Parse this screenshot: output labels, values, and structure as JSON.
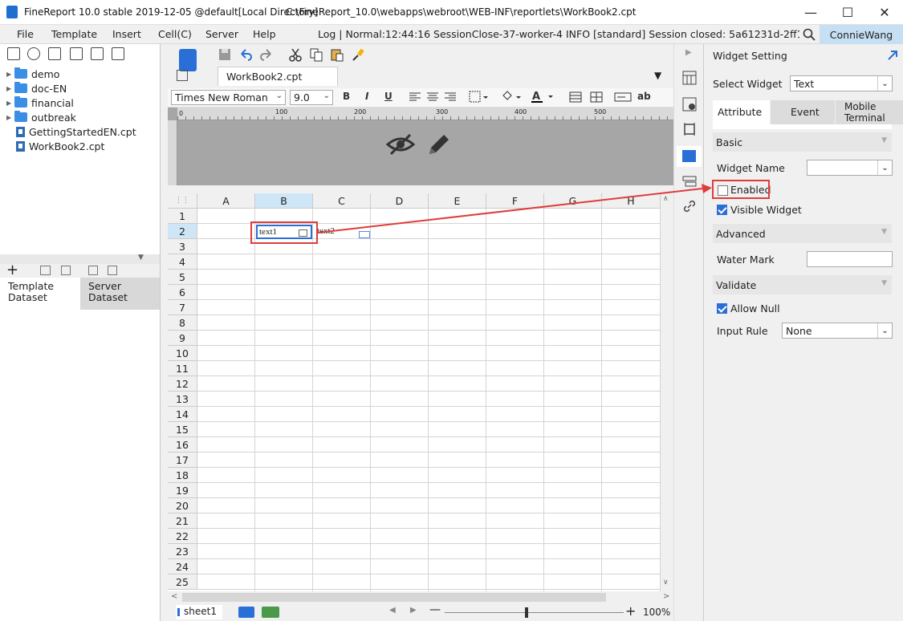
{
  "titlebar": {
    "app_title": "FineReport 10.0 stable 2019-12-05 @default[Local Directory]",
    "path": "C:\\FineReport_10.0\\webapps\\webroot\\WEB-INF\\reportlets\\WorkBook2.cpt"
  },
  "menu": {
    "items": [
      "File",
      "Template",
      "Insert",
      "Cell(C)",
      "Server",
      "Help"
    ],
    "log": "Log | Normal:12:44:16 SessionClose-37-worker-4 INFO [standard] Session closed: 5a61231d-2ff1-434e-942...",
    "user": "ConnieWang"
  },
  "tree": {
    "folders": [
      "demo",
      "doc-EN",
      "financial",
      "outbreak"
    ],
    "files": [
      "GettingStartedEN.cpt",
      "WorkBook2.cpt"
    ]
  },
  "dataset_tabs": [
    "Template Dataset",
    "Server Dataset"
  ],
  "editor": {
    "file_tab": "WorkBook2.cpt",
    "font_name": "Times New Roman",
    "font_size": "9.0",
    "format_buttons": [
      "B",
      "I",
      "U"
    ],
    "ab_button": "ab",
    "ruler_labels": [
      "0",
      "100",
      "200",
      "300",
      "400",
      "500"
    ]
  },
  "sheet": {
    "columns": [
      "A",
      "B",
      "C",
      "D",
      "E",
      "F",
      "G",
      "H"
    ],
    "rows": [
      "1",
      "2",
      "3",
      "4",
      "5",
      "6",
      "7",
      "8",
      "9",
      "10",
      "11",
      "12",
      "13",
      "14",
      "15",
      "16",
      "17",
      "18",
      "19",
      "20",
      "21",
      "22",
      "23",
      "24",
      "25"
    ],
    "cell_b2": "text1",
    "cell_c2": "text2",
    "sheet_tab": "sheet1",
    "zoom": "100%"
  },
  "widget_panel": {
    "title": "Widget Setting",
    "select_widget_label": "Select Widget",
    "select_widget_value": "Text",
    "tabs": [
      "Attribute",
      "Event",
      "Mobile Terminal"
    ],
    "basic": "Basic",
    "widget_name_label": "Widget Name",
    "enabled_label": "Enabled",
    "visible_label": "Visible Widget",
    "advanced": "Advanced",
    "water_mark_label": "Water Mark",
    "validate": "Validate",
    "allow_null_label": "Allow Null",
    "input_rule_label": "Input Rule",
    "input_rule_value": "None"
  },
  "colors": {
    "accent": "#2a6fd6",
    "highlight": "#e03c3c",
    "user_bg": "#c7dff3"
  }
}
